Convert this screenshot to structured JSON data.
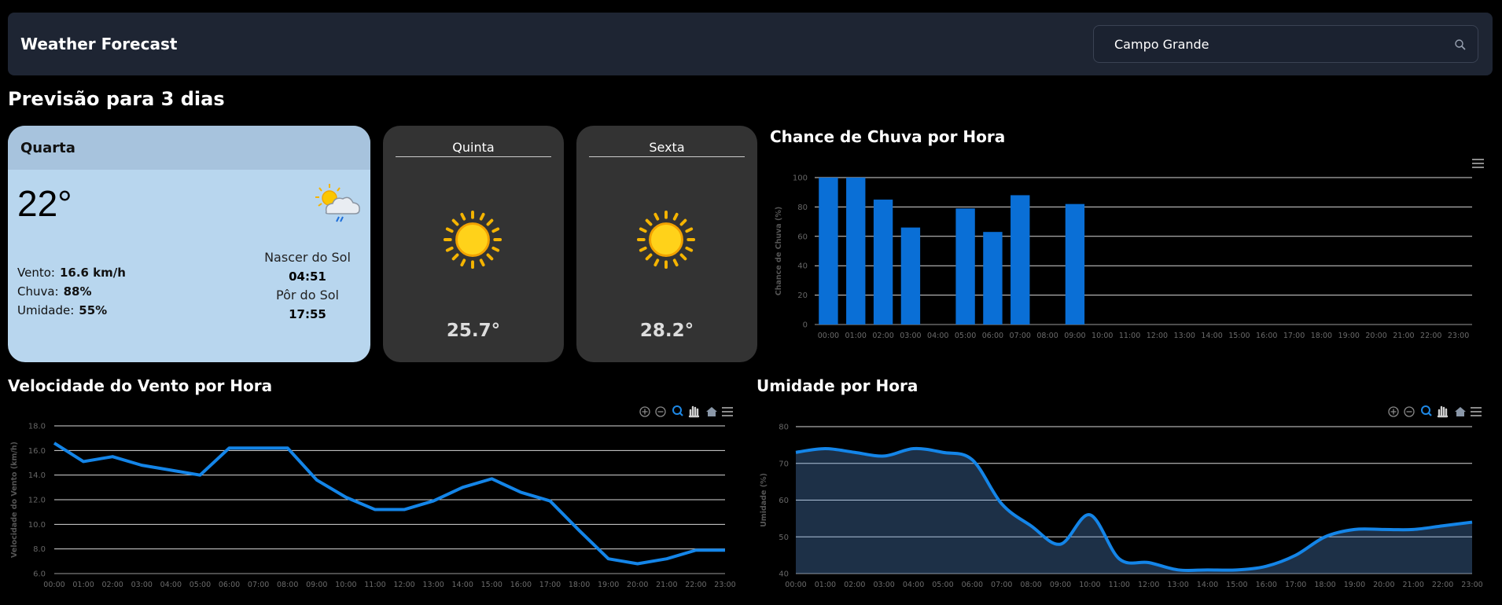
{
  "app": {
    "title": "Weather Forecast"
  },
  "search": {
    "value": "Campo Grande",
    "icon": "search-icon"
  },
  "section_title": "Previsão para 3 dias",
  "today": {
    "day": "Quarta",
    "temp": "22°",
    "icon": "partly-cloudy-rain-icon",
    "wind_label": "Vento:",
    "wind_value": "16.6 km/h",
    "rain_label": "Chuva:",
    "rain_value": "88%",
    "humidity_label": "Umidade:",
    "humidity_value": "55%",
    "sunrise_label": "Nascer do Sol",
    "sunrise_value": "04:51",
    "sunset_label": "Pôr do Sol",
    "sunset_value": "17:55"
  },
  "forecast": [
    {
      "day": "Quinta",
      "temp": "25.7°",
      "icon": "sun-icon"
    },
    {
      "day": "Sexta",
      "temp": "28.2°",
      "icon": "sun-icon"
    }
  ],
  "colors": {
    "accent": "#0a6fd6",
    "line": "#1485e8",
    "card_today": "#b8d6ee",
    "card_forecast": "#333333",
    "header": "#1e2533"
  },
  "hours": [
    "00:00",
    "01:00",
    "02:00",
    "03:00",
    "04:00",
    "05:00",
    "06:00",
    "07:00",
    "08:00",
    "09:00",
    "10:00",
    "11:00",
    "12:00",
    "13:00",
    "14:00",
    "15:00",
    "16:00",
    "17:00",
    "18:00",
    "19:00",
    "20:00",
    "21:00",
    "22:00",
    "23:00"
  ],
  "chart_data": [
    {
      "type": "bar",
      "title": "Chance de Chuva por Hora",
      "xlabel": "",
      "ylabel": "Chance de Chuva (%)",
      "ylim": [
        0,
        100
      ],
      "yticks": [
        "0",
        "20",
        "40",
        "60",
        "80",
        "100"
      ],
      "grid": true,
      "categories": [
        "00:00",
        "01:00",
        "02:00",
        "03:00",
        "04:00",
        "05:00",
        "06:00",
        "07:00",
        "08:00",
        "09:00",
        "10:00",
        "11:00",
        "12:00",
        "13:00",
        "14:00",
        "15:00",
        "16:00",
        "17:00",
        "18:00",
        "19:00",
        "20:00",
        "21:00",
        "22:00",
        "23:00"
      ],
      "values": [
        100,
        100,
        85,
        66,
        0,
        79,
        63,
        88,
        0,
        82,
        0,
        0,
        0,
        0,
        0,
        0,
        0,
        0,
        0,
        0,
        0,
        0,
        0,
        0
      ]
    },
    {
      "type": "line",
      "title": "Velocidade do Vento por Hora",
      "xlabel": "",
      "ylabel": "Velocidade do Vento (km/h)",
      "ylim": [
        6,
        18
      ],
      "yticks": [
        "6.0",
        "8.0",
        "10.0",
        "12.0",
        "14.0",
        "16.0",
        "18.0"
      ],
      "grid": true,
      "categories": [
        "00:00",
        "01:00",
        "02:00",
        "03:00",
        "04:00",
        "05:00",
        "06:00",
        "07:00",
        "08:00",
        "09:00",
        "10:00",
        "11:00",
        "12:00",
        "13:00",
        "14:00",
        "15:00",
        "16:00",
        "17:00",
        "18:00",
        "19:00",
        "20:00",
        "21:00",
        "22:00",
        "23:00"
      ],
      "values": [
        16.6,
        15.1,
        15.5,
        14.8,
        14.4,
        14.0,
        16.2,
        16.2,
        16.2,
        13.6,
        12.2,
        11.2,
        11.2,
        11.9,
        13.0,
        13.7,
        12.6,
        11.9,
        9.5,
        7.2,
        6.8,
        7.2,
        7.9,
        7.9
      ]
    },
    {
      "type": "area",
      "title": "Umidade por Hora",
      "xlabel": "",
      "ylabel": "Umidade (%)",
      "ylim": [
        40,
        80
      ],
      "yticks": [
        "40",
        "50",
        "60",
        "70",
        "80"
      ],
      "grid": true,
      "categories": [
        "00:00",
        "01:00",
        "02:00",
        "03:00",
        "04:00",
        "05:00",
        "06:00",
        "07:00",
        "08:00",
        "09:00",
        "10:00",
        "11:00",
        "12:00",
        "13:00",
        "14:00",
        "15:00",
        "16:00",
        "17:00",
        "18:00",
        "19:00",
        "20:00",
        "21:00",
        "22:00",
        "23:00"
      ],
      "values": [
        73,
        74,
        73,
        72,
        74,
        73,
        71,
        59,
        53,
        48,
        56,
        44,
        43,
        41,
        41,
        41,
        42,
        45,
        50,
        52,
        52,
        52,
        53,
        54
      ]
    }
  ]
}
